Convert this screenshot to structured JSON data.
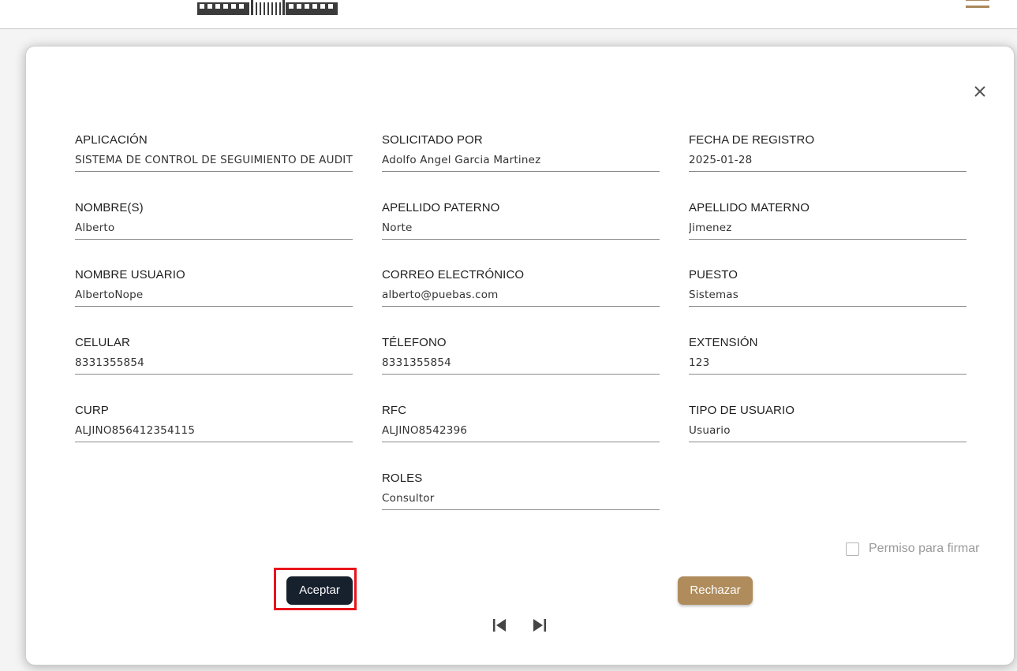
{
  "header": {
    "logo_icon": "building-logo-icon",
    "menu_icon": "hamburger-menu-icon",
    "accent_color": "#a8895a"
  },
  "modal": {
    "close_icon": "close-icon",
    "fields": {
      "aplicacion": {
        "label": "APLICACIÓN",
        "value": "SISTEMA DE CONTROL DE SEGUIMIENTO DE AUDITORIAS"
      },
      "solicitado_por": {
        "label": "SOLICITADO POR",
        "value": "Adolfo Angel Garcia Martinez"
      },
      "fecha_registro": {
        "label": "FECHA DE REGISTRO",
        "value": "2025-01-28"
      },
      "nombres": {
        "label": "NOMBRE(S)",
        "value": "Alberto"
      },
      "apellido_paterno": {
        "label": "APELLIDO PATERNO",
        "value": "Norte"
      },
      "apellido_materno": {
        "label": "APELLIDO MATERNO",
        "value": "Jimenez"
      },
      "nombre_usuario": {
        "label": "NOMBRE USUARIO",
        "value": "AlbertoNope"
      },
      "correo": {
        "label": "CORREO ELECTRÓNICO",
        "value": "alberto@puebas.com"
      },
      "puesto": {
        "label": "PUESTO",
        "value": "Sistemas"
      },
      "celular": {
        "label": "CELULAR",
        "value": "8331355854"
      },
      "telefono": {
        "label": "TÉLEFONO",
        "value": "8331355854"
      },
      "extension": {
        "label": "EXTENSIÓN",
        "value": "123"
      },
      "curp": {
        "label": "CURP",
        "value": "ALJINO856412354115"
      },
      "rfc": {
        "label": "RFC",
        "value": "ALJINO8542396"
      },
      "tipo_usuario": {
        "label": "TIPO DE USUARIO",
        "value": "Usuario"
      },
      "roles": {
        "label": "ROLES",
        "value": "Consultor"
      }
    },
    "permiso_firmar": {
      "label": "Permiso para firmar",
      "checked": false
    },
    "buttons": {
      "accept": "Aceptar",
      "reject": "Rechazar"
    },
    "pagination": {
      "first_icon": "skip-first-icon",
      "last_icon": "skip-last-icon"
    },
    "colors": {
      "accept_bg": "#17202d",
      "reject_bg": "#b08c5c",
      "highlight": "#e8151b"
    }
  }
}
